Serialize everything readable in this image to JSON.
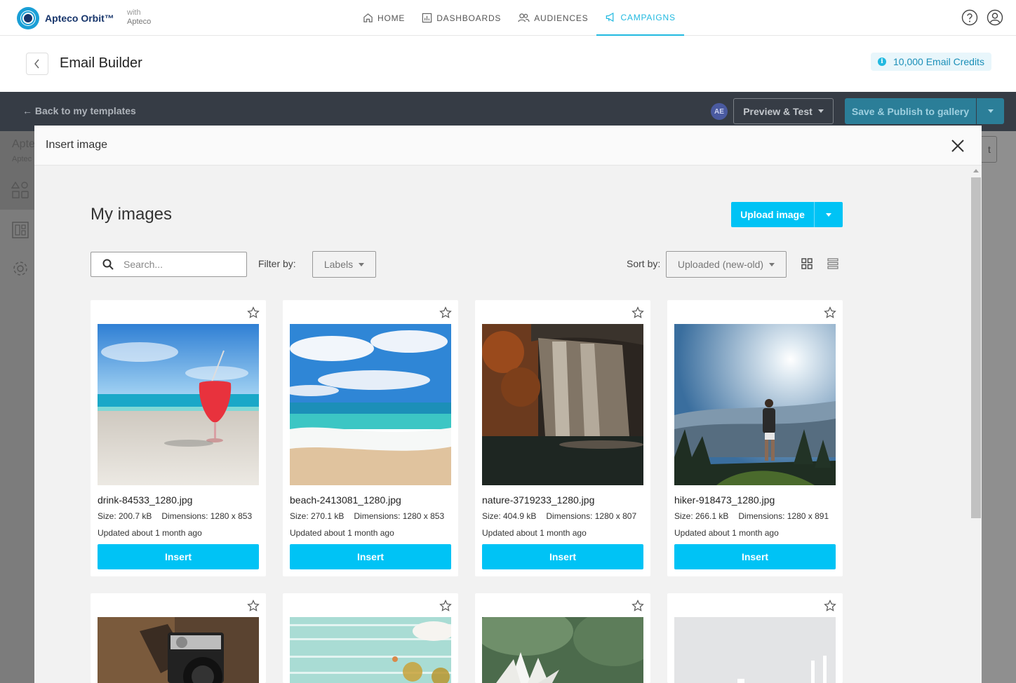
{
  "app": {
    "name": "Apteco Orbit™",
    "with_label": "with",
    "with_brand": "Apteco"
  },
  "nav": [
    {
      "label": "HOME",
      "icon": "home-icon",
      "active": false
    },
    {
      "label": "DASHBOARDS",
      "icon": "dashboard-icon",
      "active": false
    },
    {
      "label": "AUDIENCES",
      "icon": "audiences-icon",
      "active": false
    },
    {
      "label": "CAMPAIGNS",
      "icon": "campaigns-icon",
      "active": true
    }
  ],
  "header": {
    "title": "Email Builder",
    "credits": "10,000 Email Credits"
  },
  "toolbar": {
    "back_label": "Back to my templates",
    "avatar": "AE",
    "preview_label": "Preview & Test",
    "publish_label": "Save & Publish to gallery"
  },
  "editor": {
    "title_fragment": "Apte",
    "sub_fragment": "Aptec",
    "right_btn_fragment": "t"
  },
  "modal": {
    "title": "Insert image",
    "section_title": "My images",
    "upload_label": "Upload image",
    "search_placeholder": "Search...",
    "filter_label": "Filter by:",
    "labels_dd": "Labels",
    "sort_label": "Sort by:",
    "sort_value": "Uploaded (new-old)"
  },
  "images": [
    {
      "name": "drink-84533_1280.jpg",
      "size": "Size: 200.7 kB",
      "dimensions": "Dimensions: 1280 x 853",
      "updated": "Updated about 1 month ago",
      "insert": "Insert"
    },
    {
      "name": "beach-2413081_1280.jpg",
      "size": "Size: 270.1 kB",
      "dimensions": "Dimensions: 1280 x 853",
      "updated": "Updated about 1 month ago",
      "insert": "Insert"
    },
    {
      "name": "nature-3719233_1280.jpg",
      "size": "Size: 404.9 kB",
      "dimensions": "Dimensions: 1280 x 807",
      "updated": "Updated about 1 month ago",
      "insert": "Insert"
    },
    {
      "name": "hiker-918473_1280.jpg",
      "size": "Size: 266.1 kB",
      "dimensions": "Dimensions: 1280 x 891",
      "updated": "Updated about 1 month ago",
      "insert": "Insert"
    }
  ],
  "colors": {
    "accent": "#00c3f5",
    "nav_active": "#21b9e0",
    "dark_bar": "#363c45",
    "modal_bg": "#f2f2f2"
  }
}
